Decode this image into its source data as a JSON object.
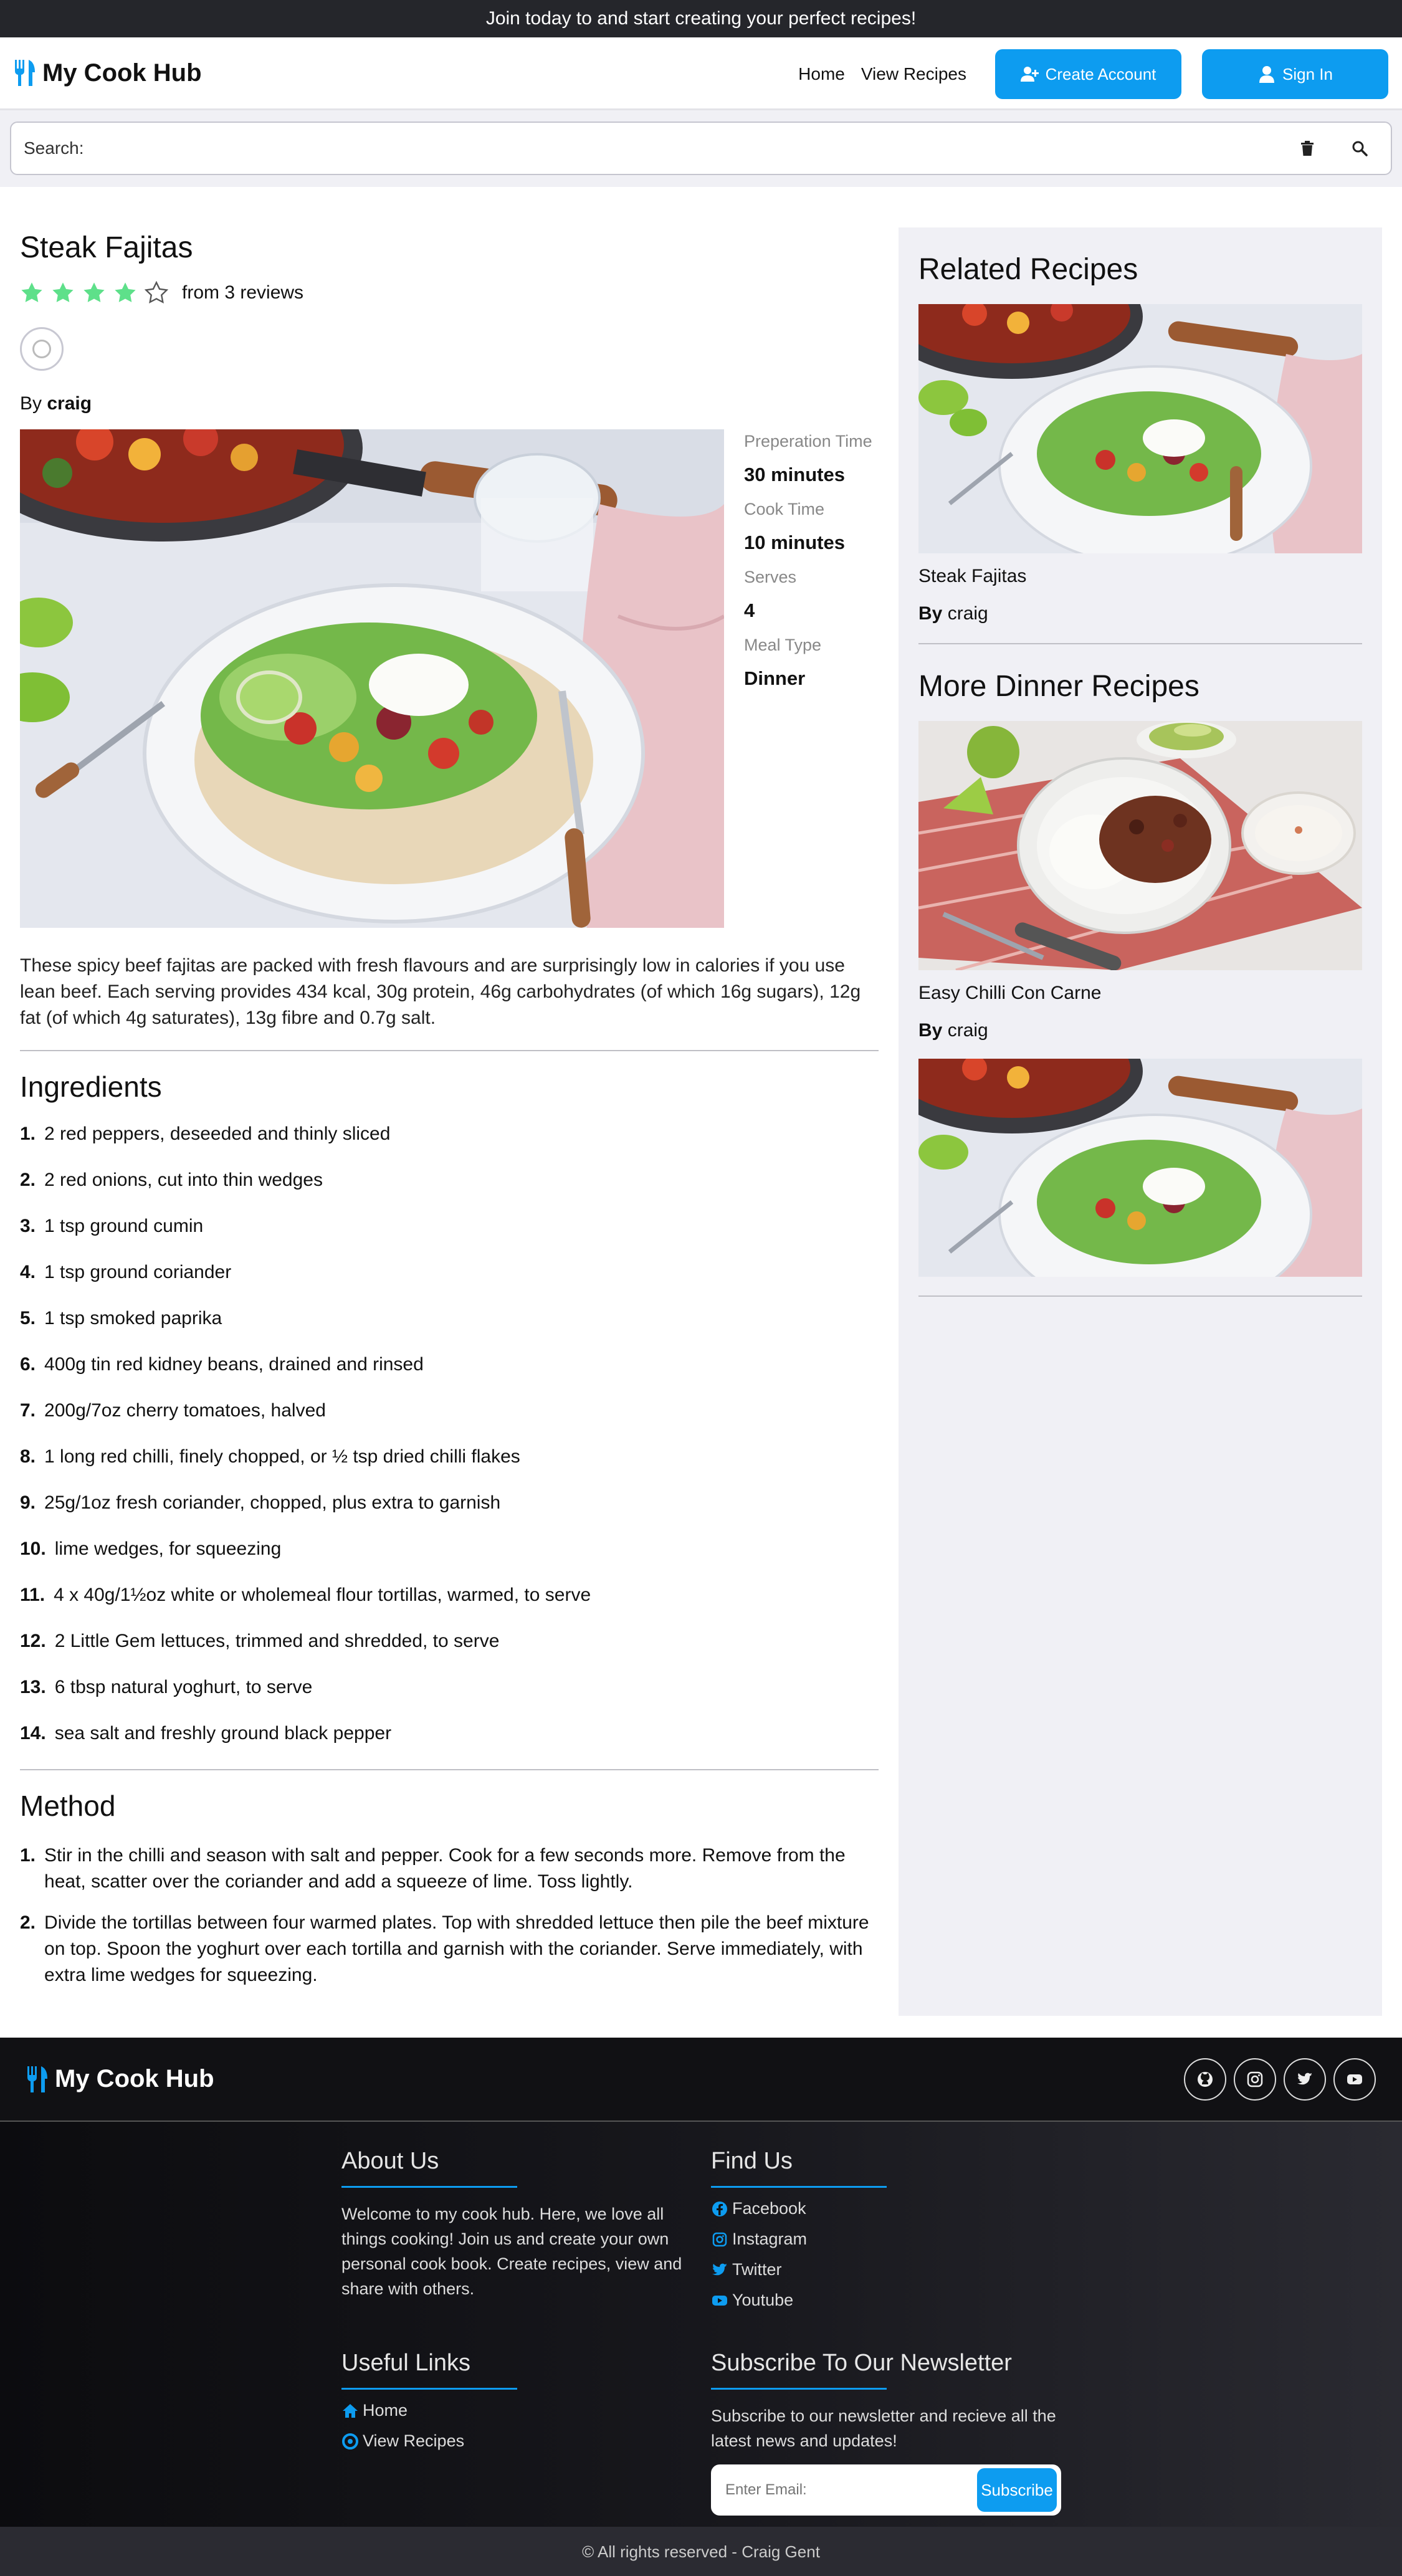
{
  "banner": {
    "text": "Join today to and start creating your perfect recipes!"
  },
  "navbar": {
    "brand": "My Cook Hub",
    "links": [
      "Home",
      "View Recipes"
    ],
    "create_account": "Create Account",
    "sign_in": "Sign In"
  },
  "search": {
    "label": "Search:",
    "placeholder": ""
  },
  "recipe": {
    "title": "Steak Fajitas",
    "rating": 4,
    "rating_max": 5,
    "reviews_text": "from 3 reviews",
    "by_prefix": "By",
    "author": "craig",
    "meta": [
      {
        "label": "Preperation Time",
        "value": "30 minutes"
      },
      {
        "label": "Cook Time",
        "value": "10 minutes"
      },
      {
        "label": "Serves",
        "value": "4"
      },
      {
        "label": "Meal Type",
        "value": "Dinner"
      }
    ],
    "description": "These spicy beef fajitas are packed with fresh flavours and are surprisingly low in calories if you use lean beef. Each serving provides 434 kcal, 30g protein, 46g carbohydrates (of which 16g sugars), 12g fat (of which 4g saturates), 13g fibre and 0.7g salt.",
    "ingredients_title": "Ingredients",
    "ingredients": [
      "2 red peppers, deseeded and thinly sliced",
      "2 red onions, cut into thin wedges",
      "1 tsp ground cumin",
      "1 tsp ground coriander",
      "1 tsp smoked paprika",
      "400g tin red kidney beans, drained and rinsed",
      "200g/7oz cherry tomatoes, halved",
      "1 long red chilli, finely chopped, or ½ tsp dried chilli flakes",
      "25g/1oz fresh coriander, chopped, plus extra to garnish",
      "lime wedges, for squeezing",
      "4 x 40g/1½oz white or wholemeal flour tortillas, warmed, to serve",
      "2 Little Gem lettuces, trimmed and shredded, to serve",
      "6 tbsp natural yoghurt, to serve",
      "sea salt and freshly ground black pepper"
    ],
    "method_title": "Method",
    "method": [
      "Stir in the chilli and season with salt and pepper. Cook for a few seconds more. Remove from the heat, scatter over the coriander and add a squeeze of lime. Toss lightly.",
      "Divide the tortillas between four warmed plates. Top with shredded lettuce then pile the beef mixture on top. Spoon the yoghurt over each tortilla and garnish with the coriander. Serve immediately, with extra lime wedges for squeezing."
    ]
  },
  "sidebar": {
    "related_title": "Related Recipes",
    "related": {
      "name": "Steak Fajitas",
      "by": "By",
      "author": "craig"
    },
    "more_title": "More Dinner Recipes",
    "more": [
      {
        "name": "Easy Chilli Con Carne",
        "by": "By",
        "author": "craig"
      }
    ]
  },
  "footer": {
    "brand": "My Cook Hub",
    "socials": [
      "github-icon",
      "instagram-icon",
      "twitter-icon",
      "youtube-icon"
    ],
    "about_title": "About Us",
    "about_text": "Welcome to my cook hub. Here, we love all things cooking! Join us and create your own personal cook book. Create recipes, view and share with others.",
    "find_title": "Find Us",
    "find_links": [
      "Facebook",
      "Instagram",
      "Twitter",
      "Youtube"
    ],
    "useful_title": "Useful Links",
    "useful_links": [
      "Home",
      "View Recipes"
    ],
    "newsletter_title": "Subscribe To Our Newsletter",
    "newsletter_text": "Subscribe to our newsletter and recieve all the latest news and updates!",
    "email_placeholder": "Enter Email:",
    "subscribe": "Subscribe",
    "copyright": "© All rights reserved - Craig Gent"
  },
  "colors": {
    "accent": "#0d9cf0",
    "star": "#5ee08a",
    "banner": "#25262b",
    "footer": "#111114"
  }
}
